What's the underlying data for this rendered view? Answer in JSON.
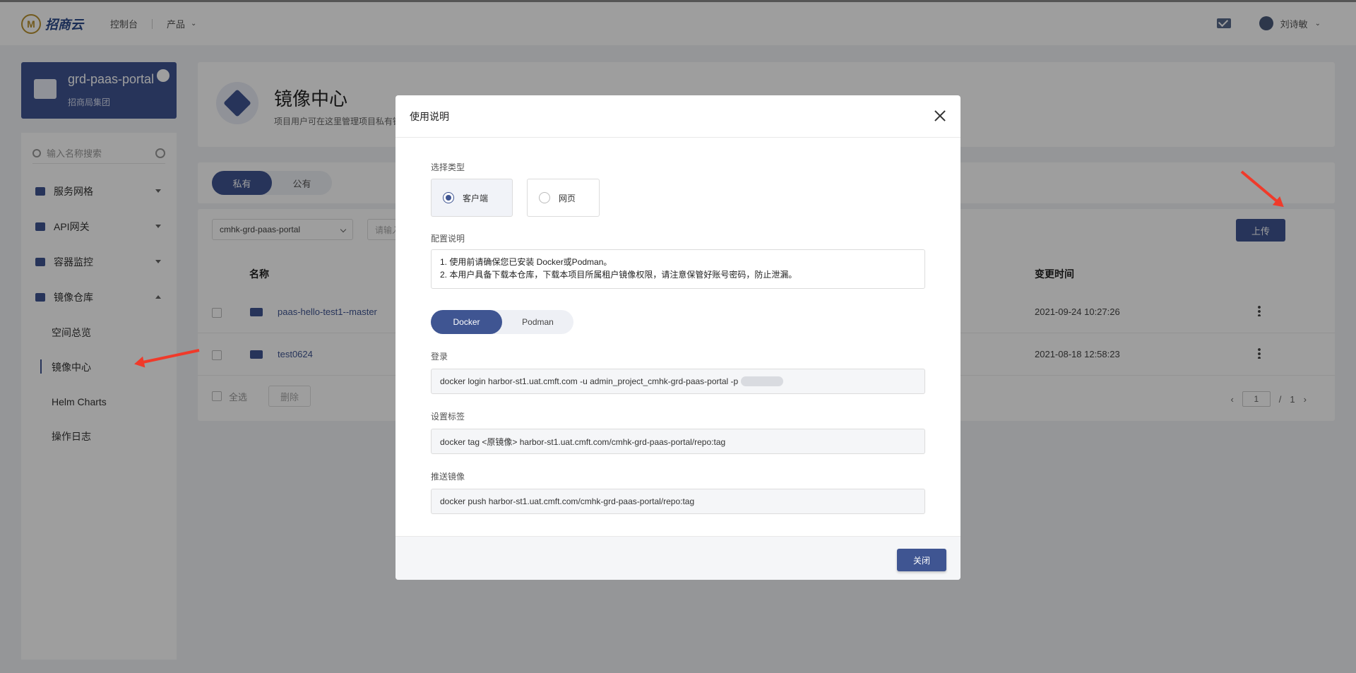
{
  "topbar": {
    "logo_text": "招商云",
    "nav_console": "控制台",
    "nav_products": "产品",
    "user_name": "刘诗敏"
  },
  "project": {
    "name": "grd-paas-portal",
    "org": "招商局集团"
  },
  "sidebar": {
    "search_placeholder": "输入名称搜索",
    "items": [
      {
        "label": "服务网格"
      },
      {
        "label": "API网关"
      },
      {
        "label": "容器监控"
      },
      {
        "label": "镜像仓库"
      }
    ],
    "sub_items": [
      {
        "label": "空间总览"
      },
      {
        "label": "镜像中心"
      },
      {
        "label": "Helm Charts"
      },
      {
        "label": "操作日志"
      }
    ]
  },
  "header": {
    "title": "镜像中心",
    "subtitle": "项目用户可在这里管理项目私有镜"
  },
  "tabs": {
    "private": "私有",
    "public": "公有"
  },
  "list": {
    "repo_select": "cmhk-grd-paas-portal",
    "search_placeholder": "请输入",
    "upload": "上传",
    "col_name": "名称",
    "col_time": "变更时间",
    "rows": [
      {
        "name": "paas-hello-test1--master",
        "time": "2021-09-24 10:27:26"
      },
      {
        "name": "test0624",
        "time": "2021-08-18 12:58:23"
      }
    ],
    "select_all": "全选",
    "delete": "删除",
    "page_current": "1",
    "page_sep": "/",
    "page_total": "1"
  },
  "modal": {
    "title": "使用说明",
    "type_label": "选择类型",
    "type_client": "客户端",
    "type_web": "网页",
    "config_label": "配置说明",
    "config_line1": "1. 使用前请确保您已安装 Docker或Podman。",
    "config_line2": "2. 本用户具备下载本仓库，下载本项目所属租户镜像权限，请注意保管好账号密码，防止泄漏。",
    "seg_docker": "Docker",
    "seg_podman": "Podman",
    "login_label": "登录",
    "login_cmd": "docker login harbor-st1.uat.cmft.com -u admin_project_cmhk-grd-paas-portal -p",
    "tag_label": "设置标签",
    "tag_cmd": "docker tag <原镜像> harbor-st1.uat.cmft.com/cmhk-grd-paas-portal/repo:tag",
    "push_label": "推送镜像",
    "push_cmd": "docker push harbor-st1.uat.cmft.com/cmhk-grd-paas-portal/repo:tag",
    "close": "关闭"
  },
  "colors": {
    "primary": "#3f5592",
    "arrow": "#f03a2a"
  }
}
